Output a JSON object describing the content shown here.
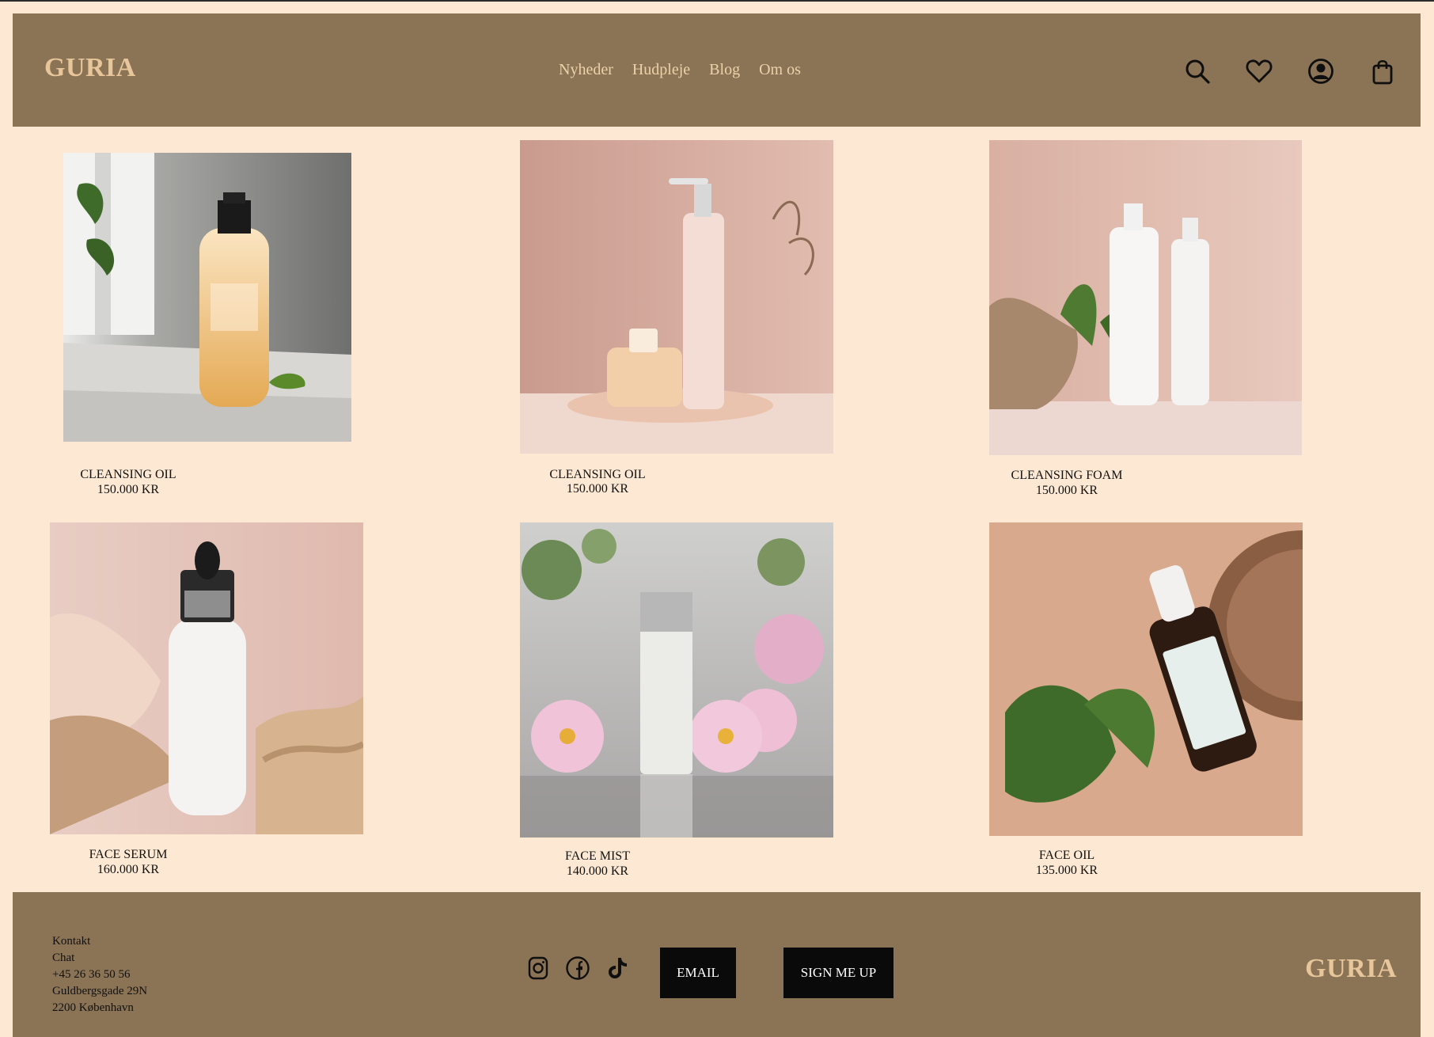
{
  "header": {
    "logo": "GURIA",
    "nav": [
      "Nyheder",
      "Hudpleje",
      "Blog",
      "Om os"
    ],
    "icons": [
      "search-icon",
      "heart-icon",
      "account-icon",
      "bag-icon"
    ]
  },
  "colors": {
    "background": "#fde9d3",
    "header_bg": "#8b7355",
    "logo": "#e6c69a",
    "nav_text": "#ecd2a8",
    "button_bg": "#0a0a0a"
  },
  "products": [
    {
      "name": "CLEANSING OIL",
      "price": "150.000 KR",
      "image": "amber oil bottle on marble counter"
    },
    {
      "name": "CLEANSING OIL",
      "price": "150.000 KR",
      "image": "pink pump bottle on tray"
    },
    {
      "name": "CLEANSING FOAM",
      "price": "150.000 KR",
      "image": "two white pump bottles with leaves"
    },
    {
      "name": "FACE SERUM",
      "price": "160.000 KR",
      "image": "white dropper bottle with silk"
    },
    {
      "name": "FACE MIST",
      "price": "140.000 KR",
      "image": "silver bottle among pink flowers"
    },
    {
      "name": "FACE OIL",
      "price": "135.000 KR",
      "image": "dark dropper bottle with leaves"
    }
  ],
  "footer": {
    "contact": [
      "Kontakt",
      "Chat",
      "+45 26 36 50 56",
      "Guldbergsgade 29N",
      "2200 København"
    ],
    "social": [
      "instagram-icon",
      "facebook-icon",
      "tiktok-icon"
    ],
    "email_label": "EMAIL",
    "signup_label": "SIGN ME UP",
    "logo": "GURIA"
  }
}
